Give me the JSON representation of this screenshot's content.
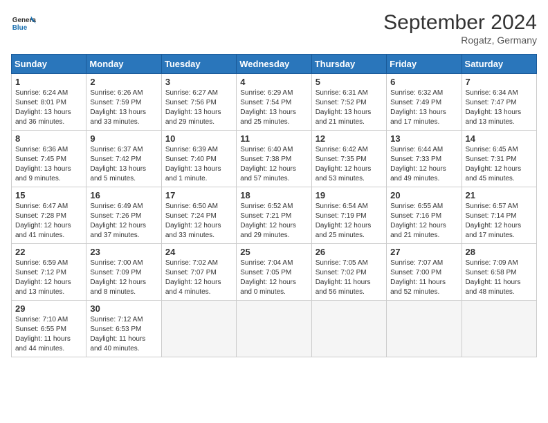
{
  "header": {
    "logo_general": "General",
    "logo_blue": "Blue",
    "month_year": "September 2024",
    "location": "Rogatz, Germany"
  },
  "weekdays": [
    "Sunday",
    "Monday",
    "Tuesday",
    "Wednesday",
    "Thursday",
    "Friday",
    "Saturday"
  ],
  "weeks": [
    [
      {
        "day": "1",
        "sunrise": "6:24 AM",
        "sunset": "8:01 PM",
        "daylight": "13 hours and 36 minutes."
      },
      {
        "day": "2",
        "sunrise": "6:26 AM",
        "sunset": "7:59 PM",
        "daylight": "13 hours and 33 minutes."
      },
      {
        "day": "3",
        "sunrise": "6:27 AM",
        "sunset": "7:56 PM",
        "daylight": "13 hours and 29 minutes."
      },
      {
        "day": "4",
        "sunrise": "6:29 AM",
        "sunset": "7:54 PM",
        "daylight": "13 hours and 25 minutes."
      },
      {
        "day": "5",
        "sunrise": "6:31 AM",
        "sunset": "7:52 PM",
        "daylight": "13 hours and 21 minutes."
      },
      {
        "day": "6",
        "sunrise": "6:32 AM",
        "sunset": "7:49 PM",
        "daylight": "13 hours and 17 minutes."
      },
      {
        "day": "7",
        "sunrise": "6:34 AM",
        "sunset": "7:47 PM",
        "daylight": "13 hours and 13 minutes."
      }
    ],
    [
      {
        "day": "8",
        "sunrise": "6:36 AM",
        "sunset": "7:45 PM",
        "daylight": "13 hours and 9 minutes."
      },
      {
        "day": "9",
        "sunrise": "6:37 AM",
        "sunset": "7:42 PM",
        "daylight": "13 hours and 5 minutes."
      },
      {
        "day": "10",
        "sunrise": "6:39 AM",
        "sunset": "7:40 PM",
        "daylight": "13 hours and 1 minute."
      },
      {
        "day": "11",
        "sunrise": "6:40 AM",
        "sunset": "7:38 PM",
        "daylight": "12 hours and 57 minutes."
      },
      {
        "day": "12",
        "sunrise": "6:42 AM",
        "sunset": "7:35 PM",
        "daylight": "12 hours and 53 minutes."
      },
      {
        "day": "13",
        "sunrise": "6:44 AM",
        "sunset": "7:33 PM",
        "daylight": "12 hours and 49 minutes."
      },
      {
        "day": "14",
        "sunrise": "6:45 AM",
        "sunset": "7:31 PM",
        "daylight": "12 hours and 45 minutes."
      }
    ],
    [
      {
        "day": "15",
        "sunrise": "6:47 AM",
        "sunset": "7:28 PM",
        "daylight": "12 hours and 41 minutes."
      },
      {
        "day": "16",
        "sunrise": "6:49 AM",
        "sunset": "7:26 PM",
        "daylight": "12 hours and 37 minutes."
      },
      {
        "day": "17",
        "sunrise": "6:50 AM",
        "sunset": "7:24 PM",
        "daylight": "12 hours and 33 minutes."
      },
      {
        "day": "18",
        "sunrise": "6:52 AM",
        "sunset": "7:21 PM",
        "daylight": "12 hours and 29 minutes."
      },
      {
        "day": "19",
        "sunrise": "6:54 AM",
        "sunset": "7:19 PM",
        "daylight": "12 hours and 25 minutes."
      },
      {
        "day": "20",
        "sunrise": "6:55 AM",
        "sunset": "7:16 PM",
        "daylight": "12 hours and 21 minutes."
      },
      {
        "day": "21",
        "sunrise": "6:57 AM",
        "sunset": "7:14 PM",
        "daylight": "12 hours and 17 minutes."
      }
    ],
    [
      {
        "day": "22",
        "sunrise": "6:59 AM",
        "sunset": "7:12 PM",
        "daylight": "12 hours and 13 minutes."
      },
      {
        "day": "23",
        "sunrise": "7:00 AM",
        "sunset": "7:09 PM",
        "daylight": "12 hours and 8 minutes."
      },
      {
        "day": "24",
        "sunrise": "7:02 AM",
        "sunset": "7:07 PM",
        "daylight": "12 hours and 4 minutes."
      },
      {
        "day": "25",
        "sunrise": "7:04 AM",
        "sunset": "7:05 PM",
        "daylight": "12 hours and 0 minutes."
      },
      {
        "day": "26",
        "sunrise": "7:05 AM",
        "sunset": "7:02 PM",
        "daylight": "11 hours and 56 minutes."
      },
      {
        "day": "27",
        "sunrise": "7:07 AM",
        "sunset": "7:00 PM",
        "daylight": "11 hours and 52 minutes."
      },
      {
        "day": "28",
        "sunrise": "7:09 AM",
        "sunset": "6:58 PM",
        "daylight": "11 hours and 48 minutes."
      }
    ],
    [
      {
        "day": "29",
        "sunrise": "7:10 AM",
        "sunset": "6:55 PM",
        "daylight": "11 hours and 44 minutes."
      },
      {
        "day": "30",
        "sunrise": "7:12 AM",
        "sunset": "6:53 PM",
        "daylight": "11 hours and 40 minutes."
      },
      null,
      null,
      null,
      null,
      null
    ]
  ]
}
